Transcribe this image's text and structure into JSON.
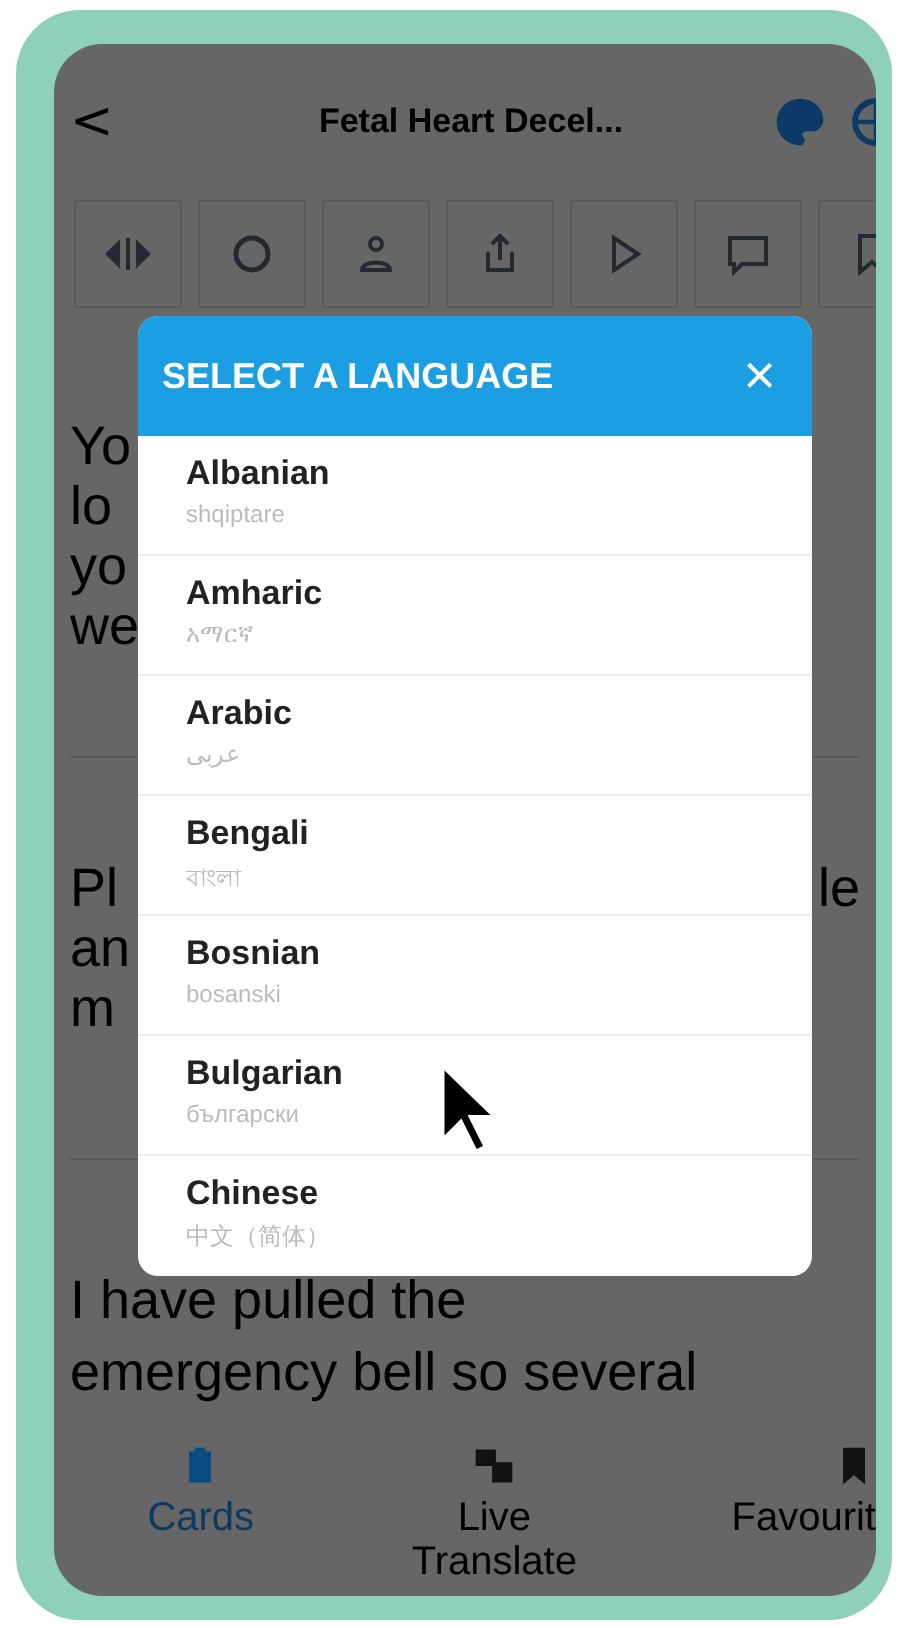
{
  "header": {
    "back": "<",
    "title": "Fetal Heart Decel..."
  },
  "content": {
    "paragraphs": [
      {
        "lines": [
          {
            "left": "Yo"
          },
          {
            "left": "lo"
          },
          {
            "left": "yo"
          },
          {
            "left": "we"
          }
        ]
      },
      {
        "lines": [
          {
            "left": "Pl",
            "right": "le"
          },
          {
            "left": "an"
          },
          {
            "left": "m"
          }
        ]
      },
      {
        "lines": [
          {
            "left": "I have pulled the"
          },
          {
            "left": "emergency bell so several"
          }
        ]
      }
    ]
  },
  "modal": {
    "title": "SELECT A LANGUAGE",
    "close": "×",
    "languages": [
      {
        "name": "Albanian",
        "native": "shqiptare"
      },
      {
        "name": "Amharic",
        "native": "አማርኛ"
      },
      {
        "name": "Arabic",
        "native": "عربى"
      },
      {
        "name": "Bengali",
        "native": "বাংলা"
      },
      {
        "name": "Bosnian",
        "native": "bosanski"
      },
      {
        "name": "Bulgarian",
        "native": "български"
      },
      {
        "name": "Chinese",
        "native": "中文（简体）"
      }
    ]
  },
  "tab_bar": [
    {
      "label": "Cards",
      "selected": true
    },
    {
      "label": "Live Translate",
      "selected": false
    },
    {
      "label": "Favourit",
      "selected": false
    }
  ]
}
